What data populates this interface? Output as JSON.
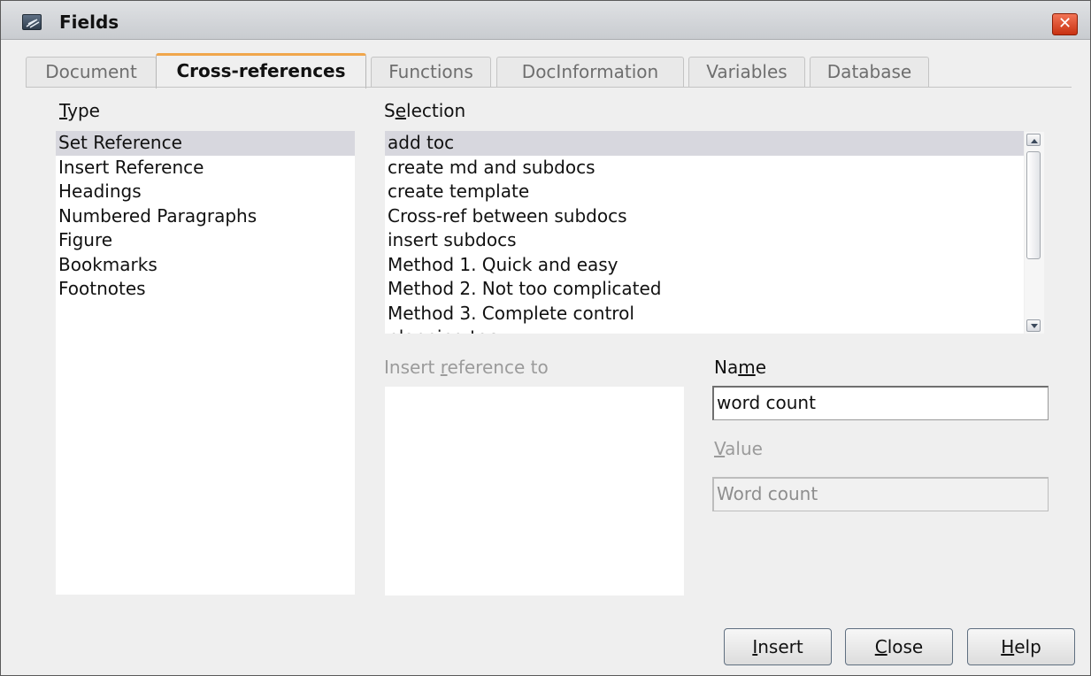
{
  "window": {
    "title": "Fields",
    "close_glyph": "✕"
  },
  "tabs": [
    {
      "label": "Document"
    },
    {
      "label": "Cross-references"
    },
    {
      "label": "Functions"
    },
    {
      "label": "DocInformation"
    },
    {
      "label": "Variables"
    },
    {
      "label": "Database"
    }
  ],
  "type": {
    "label_ul": "T",
    "label_rest": "ype",
    "items": [
      "Set Reference",
      "Insert Reference",
      "Headings",
      "Numbered Paragraphs",
      "Figure",
      "Bookmarks",
      "Footnotes"
    ]
  },
  "selection": {
    "label_pre": "S",
    "label_ul": "e",
    "label_rest": "lection",
    "items": [
      "add toc",
      "create md and subdocs",
      "create template",
      "Cross-ref between subdocs",
      "insert subdocs",
      "Method 1. Quick and easy",
      "Method 2. Not too complicated",
      "Method 3. Complete control",
      "planning toc"
    ]
  },
  "insert_reference_to": {
    "label_pre": "Insert ",
    "label_ul": "r",
    "label_rest": "eference to"
  },
  "name_field": {
    "label_pre": "Na",
    "label_ul": "m",
    "label_rest": "e",
    "value": "word count"
  },
  "value_field": {
    "label_ul": "V",
    "label_rest": "alue",
    "value": "Word count"
  },
  "buttons": {
    "insert_ul": "I",
    "insert_rest": "nsert",
    "close_ul": "C",
    "close_rest": "lose",
    "help_ul": "H",
    "help_rest": "elp"
  },
  "colors": {
    "accent_tab": "#f0a64b",
    "close_button": "#d9421e",
    "selected_row": "#d7d7de"
  }
}
